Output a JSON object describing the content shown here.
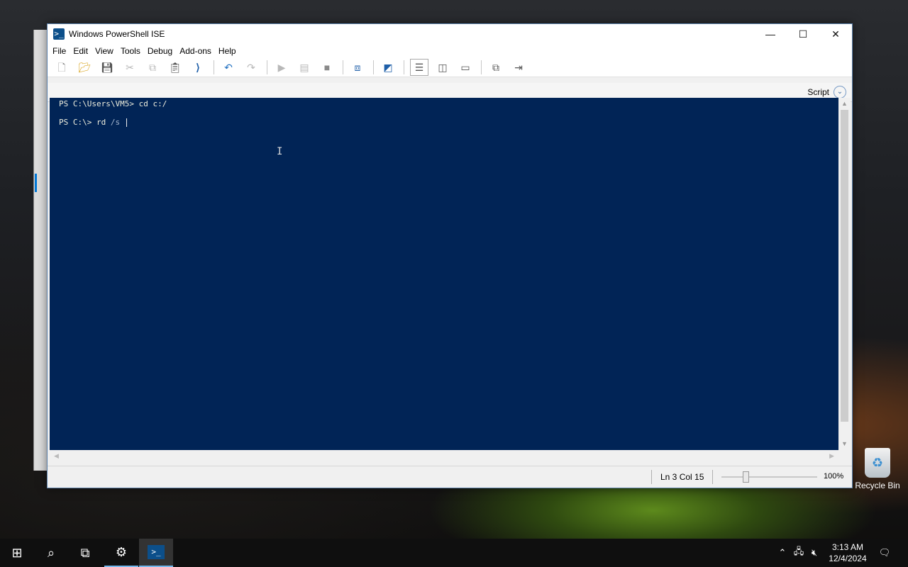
{
  "window": {
    "title": "Windows PowerShell ISE",
    "minimize_glyph": "—",
    "maximize_glyph": "☐",
    "close_glyph": "✕"
  },
  "menu": {
    "items": [
      "File",
      "Edit",
      "View",
      "Tools",
      "Debug",
      "Add-ons",
      "Help"
    ]
  },
  "toolbar": {
    "icons": [
      "new-file-icon",
      "open-folder-icon",
      "save-icon",
      "cut-icon",
      "copy-icon",
      "paste-icon",
      "powershell-icon",
      "undo-icon",
      "redo-icon",
      "run-script-icon",
      "run-selection-icon",
      "stop-icon",
      "remote-powershell-icon",
      "start-powershell-icon",
      "show-script-top-icon",
      "show-script-right-icon",
      "show-script-maximized-icon",
      "show-command-window-icon",
      "show-command-addon-icon"
    ]
  },
  "script_pane": {
    "label": "Script"
  },
  "console": {
    "line1": "PS C:\\Users\\VM5> cd c:/",
    "line2_prompt": "PS C:\\> rd ",
    "line2_arg": "/s",
    "background_color": "#012456"
  },
  "status": {
    "position": "Ln 3  Col 15",
    "zoom": "100%",
    "zoom_level": 1.0
  },
  "desktop": {
    "recycle_bin_label": "Recycle Bin"
  },
  "taskbar": {
    "time": "3:13 AM",
    "date": "12/4/2024"
  }
}
